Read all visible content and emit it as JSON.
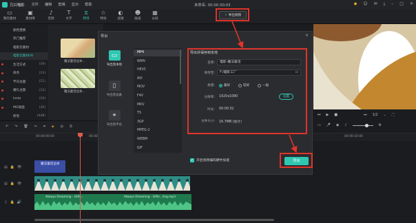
{
  "app": {
    "name": "万兴喵影",
    "menu": [
      "文件",
      "编辑",
      "剪辑",
      "显示",
      "帮助"
    ],
    "window_title": "未命名: 00:00:30:03"
  },
  "toolbar": {
    "items": [
      "我的素材",
      "素材库",
      "音频",
      "文字",
      "转场",
      "特效",
      "滤镜",
      "贴纸",
      "分屏"
    ],
    "active": "转场",
    "export_label": "导出视频"
  },
  "left_panel": {
    "items": [
      {
        "label": "颜色变换",
        "count": "",
        "dot": false,
        "selected": false
      },
      {
        "label": "热门推荐",
        "count": "",
        "dot": false,
        "selected": false
      },
      {
        "label": "喵影云素材",
        "count": "",
        "dot": false,
        "selected": false
      },
      {
        "label": "喵影云素材(9)",
        "count": "",
        "dot": false,
        "selected": true
      },
      {
        "label": "生活方式",
        "count": "(19)",
        "dot": true,
        "selected": false
      },
      {
        "label": "商务",
        "count": "(13)",
        "dot": true,
        "selected": false
      },
      {
        "label": "节日主题",
        "count": "(11)",
        "dot": true,
        "selected": false
      },
      {
        "label": "婚礼主题",
        "count": "(12)",
        "dot": true,
        "selected": false
      },
      {
        "label": "Insta",
        "count": "(19)",
        "dot": true,
        "selected": false
      },
      {
        "label": "MG动画",
        "count": "(30)",
        "dot": true,
        "selected": false
      },
      {
        "label": "所有",
        "count": "(448)",
        "dot": false,
        "selected": false
      }
    ]
  },
  "media": {
    "thumbs": [
      "魔法童话边本…",
      "魔法童话边本…"
    ]
  },
  "dialog": {
    "title": "导出",
    "close": "×",
    "side_options": [
      "导出到本地",
      "导出到设备",
      "导出到平台"
    ],
    "formats": [
      "MP4",
      "WMV",
      "HEVC",
      "AVI",
      "MOV",
      "F4V",
      "MKV",
      "TS",
      "3GP",
      "MPEG-2",
      "WEBM",
      "GIF"
    ],
    "selected_format": "MP4",
    "settings_title": "导出并保存到本地",
    "name_label": "名称:",
    "name_value": "喵影-魔法童话",
    "save_label": "保存至:",
    "save_value": "F:/喵影工厂",
    "quality_label": "质量:",
    "quality_options": [
      "最好",
      "较好",
      "一般"
    ],
    "quality_selected": "最好",
    "resolution_label": "分辨率:",
    "resolution_value": "1920x1080",
    "settings_btn": "设置",
    "duration_label": "时长:",
    "duration_value": "00:00:32",
    "size_label": "文件大小:",
    "size_value": "16.7MB (估计)",
    "gpu_label": "开启视频编码硬件加速",
    "export_btn": "导出"
  },
  "preview": {
    "page": "1/2"
  },
  "timeline": {
    "ruler": [
      "00:00:00:00",
      "00:00:05:00",
      "00:00:10:00"
    ],
    "text_clip": "魔法童话边本",
    "audio_clip": "Always Dreaming - Gifts…",
    "audio_clip2": "Always Dreaming - Gifts…ling.mp3"
  },
  "colors": {
    "accent": "#2fc7b2",
    "highlight": "#e0342a"
  }
}
